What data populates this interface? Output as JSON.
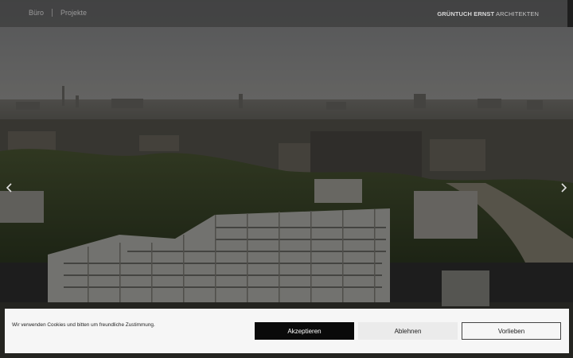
{
  "nav": {
    "items": [
      {
        "label": "Büro"
      },
      {
        "label": "Projekte"
      }
    ]
  },
  "brand": {
    "bold": "GRÜNTUCH ERNST",
    "thin": "ARCHITEKTEN"
  },
  "slider": {
    "prev_icon": "chevron-left-icon",
    "next_icon": "chevron-right-icon"
  },
  "cookie": {
    "message": "Wir verwenden Cookies und bitten um freundliche Zustimmung.",
    "accept_label": "Akzeptieren",
    "decline_label": "Ablehnen",
    "prefs_label": "Vorlieben"
  },
  "colors": {
    "accept_bg": "#0a0a0a",
    "banner_bg": "#f6f6f6"
  }
}
